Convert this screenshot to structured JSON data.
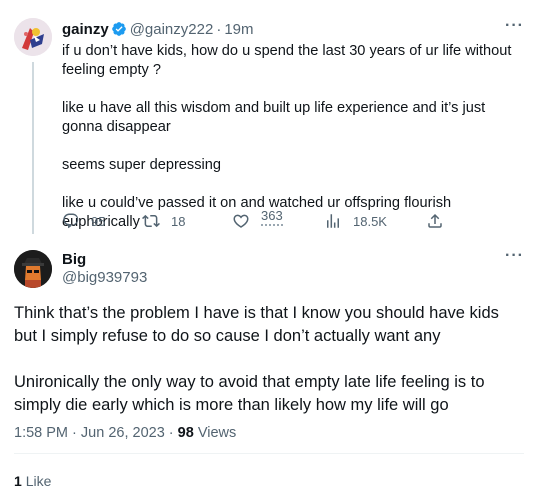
{
  "parent_tweet": {
    "display_name": "gainzy",
    "handle": "@gainzy222",
    "separator": "·",
    "time_ago": "19m",
    "paragraphs": [
      "if u don’t have kids, how do u spend the last 30 years of ur life without feeling empty ?",
      "like u have all this wisdom and built up life experience and it’s just gonna disappear",
      "seems super depressing",
      "like u could’ve passed it on and watched ur offspring flourish euphorically"
    ],
    "replies": "95",
    "reposts": "18",
    "likes": "363",
    "views": "18.5K",
    "more_label": "···",
    "verified_color": "#1d9bf0"
  },
  "reply_tweet": {
    "display_name": "Big",
    "handle": "@big939793",
    "paragraphs": [
      "Think that’s the problem I have is that I know you should have kids but I simply refuse to do so cause I don’t actually want any",
      "Unironically the only way to avoid that empty late life feeling is to simply die early which is more than likely how my life will go"
    ],
    "time": "1:58 PM",
    "date": "Jun 26, 2023",
    "dot": "·",
    "views_count": "98",
    "views_label": "Views",
    "like_count": "1",
    "like_label": "Like",
    "more_label": "···"
  }
}
